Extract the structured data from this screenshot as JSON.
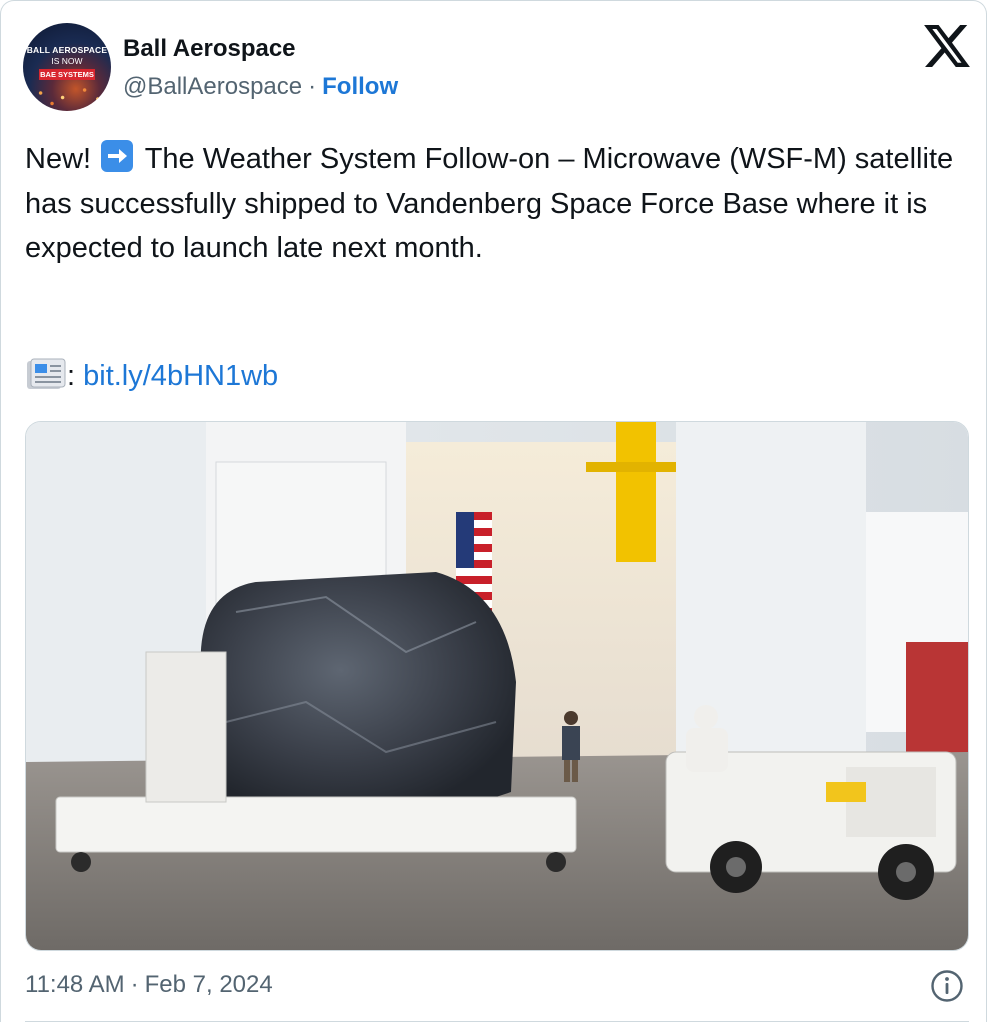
{
  "author": {
    "name": "Ball Aerospace",
    "handle": "@BallAerospace",
    "separator": "·",
    "follow_label": "Follow",
    "avatar": {
      "line1": "BALL AEROSPACE",
      "line2": "IS NOW",
      "badge": "BAE SYSTEMS"
    }
  },
  "platform_icon": "x-logo-icon",
  "tweet": {
    "text_before_emoji": "New!",
    "emoji": "arrow-right-emoji-icon",
    "text_after_emoji": "The Weather System Follow-on – Microwave (WSF-M) satellite has successfully shipped to Vandenberg Space Force Base where it is expected to launch late next month.",
    "link_prefix_icon": "newspaper-icon",
    "link_prefix": ":",
    "link_text": "bit.ly/4bHN1wb"
  },
  "media": {
    "icon": "photo-icon",
    "description": "Satellite covered in silver wrap on a white transport dolly being towed by a tug vehicle inside a cleanroom hangar with an American flag"
  },
  "footer": {
    "time": "11:48 AM",
    "separator": "·",
    "date": "Feb 7, 2024",
    "info_icon": "info-icon"
  },
  "colors": {
    "link": "#1d77d6",
    "text": "#0f1419",
    "muted": "#536471",
    "border": "#cfd9de"
  }
}
